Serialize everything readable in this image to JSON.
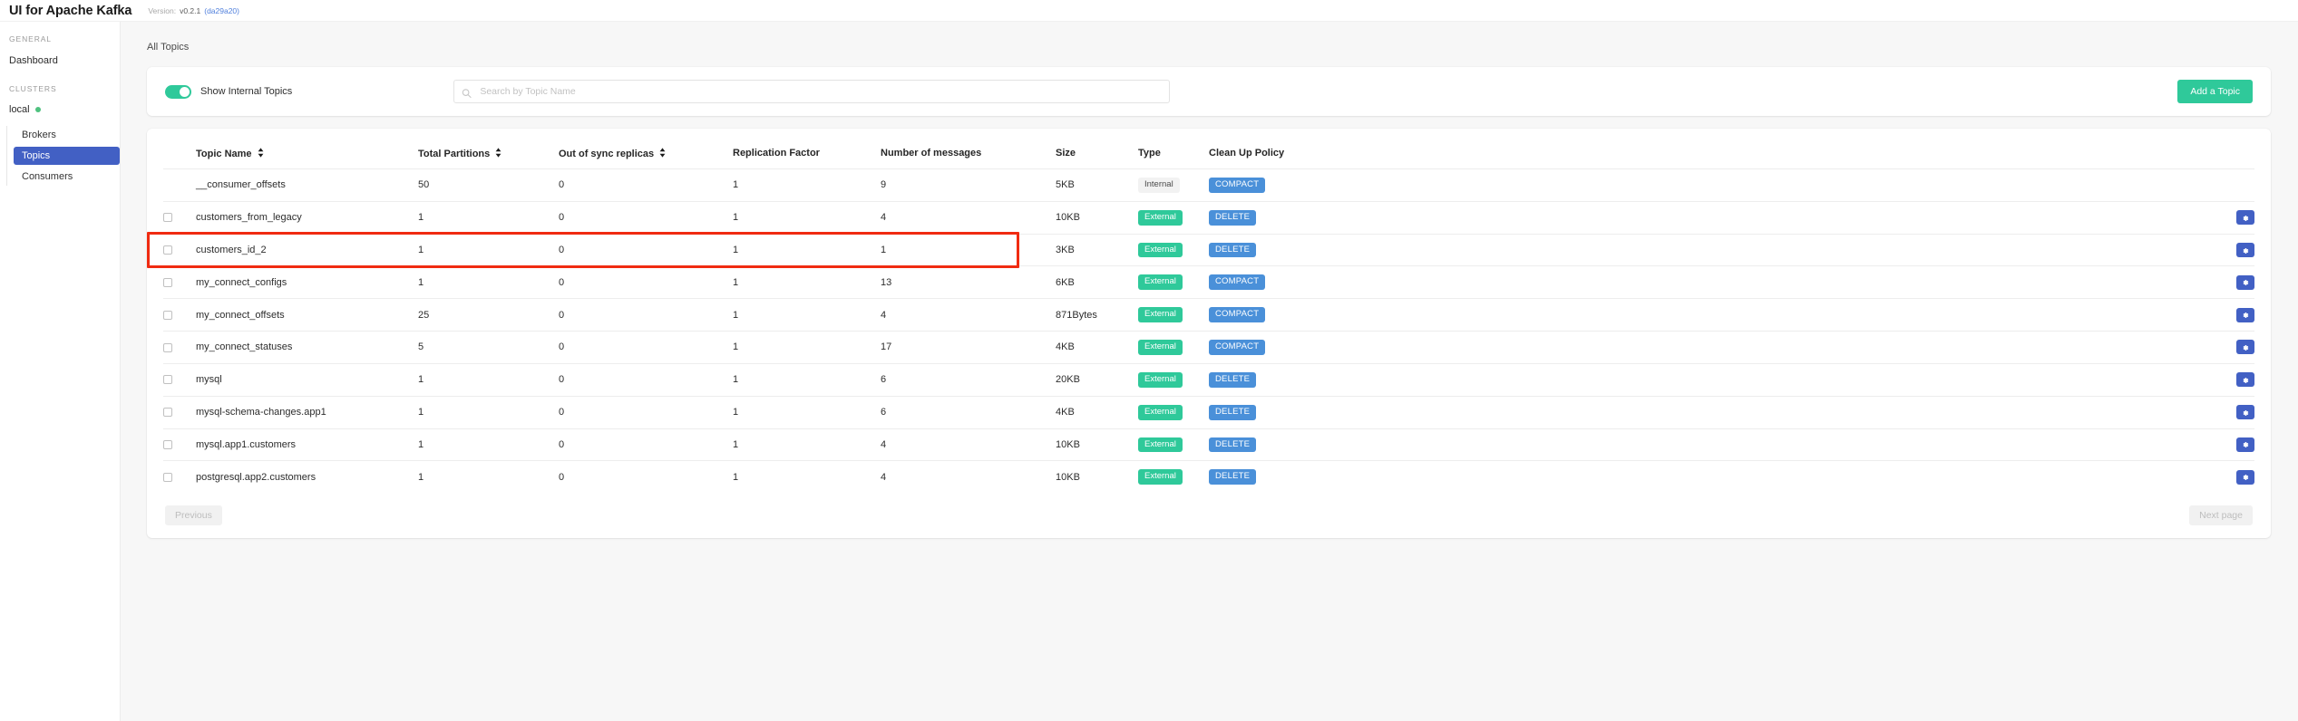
{
  "navbar": {
    "brand": "UI for Apache Kafka",
    "version_label": "Version:",
    "version_number": "v0.2.1",
    "version_hash": "(da29a20)"
  },
  "sidebar": {
    "general_label": "GENERAL",
    "dashboard_label": "Dashboard",
    "clusters_label": "CLUSTERS",
    "cluster_name": "local",
    "cluster_status_color": "#4ec17f",
    "sub_items": [
      {
        "label": "Brokers",
        "active": false
      },
      {
        "label": "Topics",
        "active": true
      },
      {
        "label": "Consumers",
        "active": false
      }
    ]
  },
  "main": {
    "breadcrumb": "All Topics",
    "toggle_label": "Show Internal Topics",
    "toggle_on": true,
    "search_placeholder": "Search by Topic Name",
    "search_value": "",
    "add_topic_label": "Add a Topic",
    "accent_green": "#2fc99a",
    "accent_blue": "#4260c4",
    "highlight_color": "#f02b11"
  },
  "table": {
    "headers": {
      "topic_name": "Topic Name",
      "total_partitions": "Total Partitions",
      "out_of_sync": "Out of sync replicas",
      "replication_factor": "Replication Factor",
      "number_of_messages": "Number of messages",
      "size": "Size",
      "type": "Type",
      "clean_up_policy": "Clean Up Policy"
    },
    "rows": [
      {
        "name": "__consumer_offsets",
        "partitions": "50",
        "out_of_sync": "0",
        "replication": "1",
        "messages": "9",
        "size": "5KB",
        "type": "Internal",
        "policy": "COMPACT",
        "checkbox": false,
        "gear": false,
        "highlighted": false
      },
      {
        "name": "customers_from_legacy",
        "partitions": "1",
        "out_of_sync": "0",
        "replication": "1",
        "messages": "4",
        "size": "10KB",
        "type": "External",
        "policy": "DELETE",
        "checkbox": true,
        "gear": true,
        "highlighted": false
      },
      {
        "name": "customers_id_2",
        "partitions": "1",
        "out_of_sync": "0",
        "replication": "1",
        "messages": "1",
        "size": "3KB",
        "type": "External",
        "policy": "DELETE",
        "checkbox": true,
        "gear": true,
        "highlighted": true
      },
      {
        "name": "my_connect_configs",
        "partitions": "1",
        "out_of_sync": "0",
        "replication": "1",
        "messages": "13",
        "size": "6KB",
        "type": "External",
        "policy": "COMPACT",
        "checkbox": true,
        "gear": true,
        "highlighted": false
      },
      {
        "name": "my_connect_offsets",
        "partitions": "25",
        "out_of_sync": "0",
        "replication": "1",
        "messages": "4",
        "size": "871Bytes",
        "type": "External",
        "policy": "COMPACT",
        "checkbox": true,
        "gear": true,
        "highlighted": false
      },
      {
        "name": "my_connect_statuses",
        "partitions": "5",
        "out_of_sync": "0",
        "replication": "1",
        "messages": "17",
        "size": "4KB",
        "type": "External",
        "policy": "COMPACT",
        "checkbox": true,
        "gear": true,
        "highlighted": false
      },
      {
        "name": "mysql",
        "partitions": "1",
        "out_of_sync": "0",
        "replication": "1",
        "messages": "6",
        "size": "20KB",
        "type": "External",
        "policy": "DELETE",
        "checkbox": true,
        "gear": true,
        "highlighted": false
      },
      {
        "name": "mysql-schema-changes.app1",
        "partitions": "1",
        "out_of_sync": "0",
        "replication": "1",
        "messages": "6",
        "size": "4KB",
        "type": "External",
        "policy": "DELETE",
        "checkbox": true,
        "gear": true,
        "highlighted": false
      },
      {
        "name": "mysql.app1.customers",
        "partitions": "1",
        "out_of_sync": "0",
        "replication": "1",
        "messages": "4",
        "size": "10KB",
        "type": "External",
        "policy": "DELETE",
        "checkbox": true,
        "gear": true,
        "highlighted": false
      },
      {
        "name": "postgresql.app2.customers",
        "partitions": "1",
        "out_of_sync": "0",
        "replication": "1",
        "messages": "4",
        "size": "10KB",
        "type": "External",
        "policy": "DELETE",
        "checkbox": true,
        "gear": true,
        "highlighted": false
      }
    ]
  },
  "pagination": {
    "previous_label": "Previous",
    "next_label": "Next page"
  }
}
